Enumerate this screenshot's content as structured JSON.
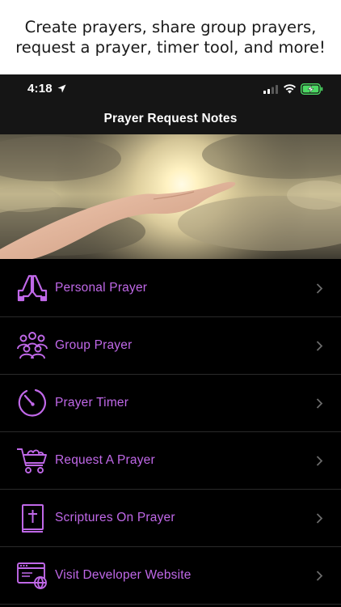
{
  "promo": {
    "line1": "Create prayers, share group prayers,",
    "line2": "request a prayer, timer tool, and more!"
  },
  "status_bar": {
    "time": "4:18",
    "icons": [
      "location-arrow-icon",
      "cellular-signal-icon",
      "wifi-icon",
      "battery-charging-icon"
    ]
  },
  "nav": {
    "title": "Prayer Request Notes"
  },
  "hero": {
    "description_icon": "hand-reaching-to-sky"
  },
  "colors": {
    "accent": "#c068e8",
    "background": "#000000",
    "bar": "#151515",
    "battery": "#4cd964"
  },
  "menu": {
    "items": [
      {
        "label": "Personal Prayer",
        "icon": "praying-hands-icon"
      },
      {
        "label": "Group Prayer",
        "icon": "group-people-icon"
      },
      {
        "label": "Prayer Timer",
        "icon": "timer-icon"
      },
      {
        "label": "Request A Prayer",
        "icon": "cart-icon"
      },
      {
        "label": "Scriptures On Prayer",
        "icon": "bible-icon"
      },
      {
        "label": "Visit Developer Website",
        "icon": "web-browser-icon"
      }
    ]
  }
}
